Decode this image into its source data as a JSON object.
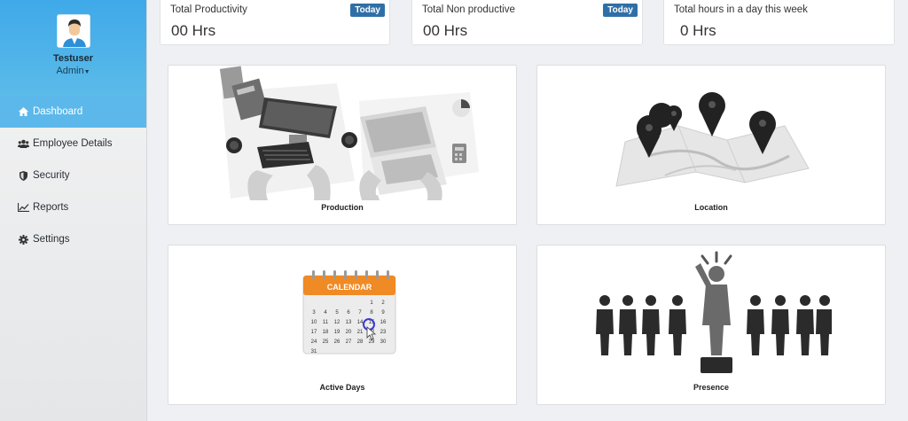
{
  "user": {
    "name": "Testuser",
    "role": "Admin"
  },
  "sidebar": {
    "items": [
      {
        "label": "Dashboard",
        "icon": "home-icon",
        "active": true
      },
      {
        "label": "Employee Details",
        "icon": "users-icon",
        "active": false
      },
      {
        "label": "Security",
        "icon": "shield-icon",
        "active": false
      },
      {
        "label": "Reports",
        "icon": "line-chart-icon",
        "active": false
      },
      {
        "label": "Settings",
        "icon": "gear-icon",
        "active": false
      }
    ]
  },
  "stats": [
    {
      "title": "Total Productivity",
      "value": "00 Hrs",
      "badge": "Today"
    },
    {
      "title": "Total Non productive",
      "value": "00 Hrs",
      "badge": "Today"
    },
    {
      "title": "Total hours in a day this week",
      "value": "0 Hrs"
    }
  ],
  "tiles": [
    {
      "label": "Production",
      "icon": "workstation-illustration"
    },
    {
      "label": "Location",
      "icon": "map-pins-illustration"
    },
    {
      "label": "Active Days",
      "icon": "calendar-illustration",
      "calendar_header": "CALENDAR",
      "calendar_numbers": [
        "1",
        "2",
        "3",
        "4",
        "5",
        "6",
        "7",
        "8",
        "9",
        "10",
        "11",
        "12",
        "13",
        "14",
        "15",
        "16",
        "17",
        "18",
        "19",
        "20",
        "21",
        "22",
        "23",
        "24",
        "25",
        "26",
        "27",
        "28",
        "29",
        "30",
        "31"
      ]
    },
    {
      "label": "Presence",
      "icon": "people-presence-illustration"
    }
  ],
  "colors": {
    "accent": "#5cb8ea",
    "badge": "#2f6fa7",
    "calendar": "#f08a24"
  }
}
